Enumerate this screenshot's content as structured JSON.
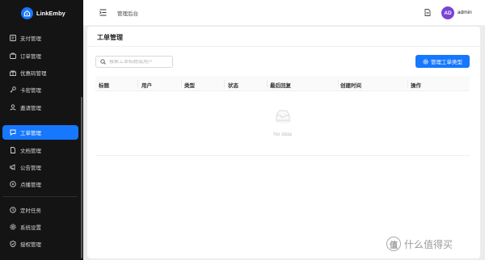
{
  "brand": {
    "name": "LinkEmby"
  },
  "sidebar": {
    "items": [
      {
        "label": "支付管理",
        "icon": "card-icon"
      },
      {
        "label": "订单管理",
        "icon": "cart-icon"
      },
      {
        "label": "优惠码管理",
        "icon": "gift-icon"
      },
      {
        "label": "卡密管理",
        "icon": "key-icon"
      },
      {
        "label": "邀请管理",
        "icon": "user-icon"
      },
      {
        "label": "工单管理",
        "icon": "ticket-icon",
        "active": true
      },
      {
        "label": "文档管理",
        "icon": "doc-icon"
      },
      {
        "label": "公告管理",
        "icon": "megaphone-icon"
      },
      {
        "label": "点播管理",
        "icon": "vod-icon"
      },
      {
        "label": "定时任务",
        "icon": "clock-icon"
      },
      {
        "label": "系统设置",
        "icon": "gear-icon"
      },
      {
        "label": "授权管理",
        "icon": "shield-icon"
      }
    ]
  },
  "header": {
    "breadcrumb": "管理后台",
    "user": {
      "initials": "AD",
      "name": "admin"
    }
  },
  "page": {
    "title": "工单管理",
    "search_placeholder": "搜索工单标题或用户",
    "primary_button": "管理工单类型",
    "table": {
      "columns": [
        "标题",
        "用户",
        "类型",
        "状态",
        "最后回复",
        "创建时间",
        "操作"
      ],
      "rows": [],
      "empty_text": "No data"
    }
  },
  "watermark": {
    "icon_glyph": "值",
    "text": "什么值得买"
  },
  "colors": {
    "accent": "#1677ff",
    "sidebar_bg": "#141414",
    "avatar": "#7a43d6"
  }
}
